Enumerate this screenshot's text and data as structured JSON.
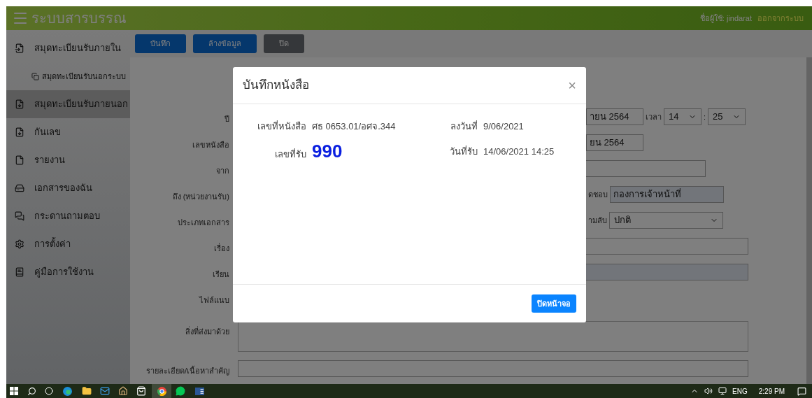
{
  "header": {
    "title": "ระบบสารบรรณ",
    "user": "ชื่อผู้ใช้: jindarat",
    "logout": "ออกจากระบบ"
  },
  "sidebar": {
    "items": [
      {
        "label": "สมุดทะเบียนรับภายใน",
        "selected": false,
        "children": [
          {
            "label": "สมุดทะเบียนรับนอกระบบ",
            "selected": false
          }
        ]
      },
      {
        "label": "สมุดทะเบียนรับภายนอก",
        "selected": true
      },
      {
        "label": "กันเลข",
        "selected": false
      },
      {
        "label": "รายงาน",
        "selected": false
      },
      {
        "label": "เอกสารของฉัน",
        "selected": false
      },
      {
        "label": "กระดานถามตอบ",
        "selected": false
      },
      {
        "label": "การตั้งค่า",
        "selected": false
      },
      {
        "label": "คู่มือการใช้งาน",
        "selected": false
      }
    ]
  },
  "toolbar": {
    "buttons": [
      {
        "label": "บันทึก",
        "kind": "primary"
      },
      {
        "label": "ล้างข้อมูล",
        "kind": "primary"
      },
      {
        "label": "ปิด",
        "kind": "secondary"
      }
    ]
  },
  "form": {
    "rows": [
      {
        "label": "ปี",
        "kind": "split",
        "fields": [
          {
            "kind": "text",
            "value": "ายน 2564"
          },
          {
            "kind": "label",
            "text": "เวลา"
          },
          {
            "kind": "select",
            "value": "14"
          },
          {
            "kind": "label",
            "text": ":"
          },
          {
            "kind": "select",
            "value": "25"
          }
        ]
      },
      {
        "label": "เลขหนังสือ",
        "kind": "split",
        "fields": [
          {
            "kind": "text",
            "value": "ยน 2564"
          }
        ]
      },
      {
        "label": "จาก",
        "kind": "full",
        "fields": [
          {
            "kind": "text",
            "readonly": false
          }
        ]
      },
      {
        "label": "ถึง (หน่วยงานรับ)",
        "kind": "split",
        "fields": [
          {
            "kind": "label",
            "text": "ดชอบ"
          },
          {
            "kind": "text",
            "value": "กองการเจ้าหน้าที่",
            "readonly": true
          }
        ]
      },
      {
        "label": "ประเภทเอกสาร",
        "kind": "split",
        "fields": [
          {
            "kind": "label",
            "text": "ามลับ"
          },
          {
            "kind": "select",
            "value": "ปกติ"
          }
        ]
      },
      {
        "label": "เรื่อง",
        "kind": "full",
        "fields": [
          {
            "kind": "text",
            "readonly": false
          }
        ]
      },
      {
        "label": "เรียน",
        "kind": "full",
        "fields": [
          {
            "kind": "text",
            "readonly": true
          }
        ]
      },
      {
        "label": "ไฟล์แนบ",
        "kind": "split",
        "fields": []
      },
      {
        "label": "สิ่งที่ส่งมาด้วย",
        "kind": "full",
        "fields": [
          {
            "kind": "textarea"
          }
        ]
      },
      {
        "label": "รายละเอียด/เนื้อหาสำคัญ",
        "kind": "full",
        "fields": [
          {
            "kind": "text",
            "readonly": false
          }
        ]
      }
    ]
  },
  "modal": {
    "title": "บันทึกหนังสือ",
    "close": "×",
    "rows": [
      [
        {
          "label": "เลขที่หนังสือ",
          "value": "ศธ 0653.01/อศจ.344",
          "kind": "normal"
        },
        {
          "label": "ลงวันที่",
          "value": "9/06/2021",
          "kind": "normal"
        }
      ],
      [
        {
          "label": "เลขที่รับ",
          "value": "990",
          "kind": "big"
        },
        {
          "label": "วันที่รับ",
          "value": "14/06/2021 14:25",
          "kind": "normal"
        }
      ]
    ],
    "button": "ปิดหน้าจอ"
  },
  "taskbar": {
    "language": "ENG",
    "time": "2:29 PM"
  }
}
